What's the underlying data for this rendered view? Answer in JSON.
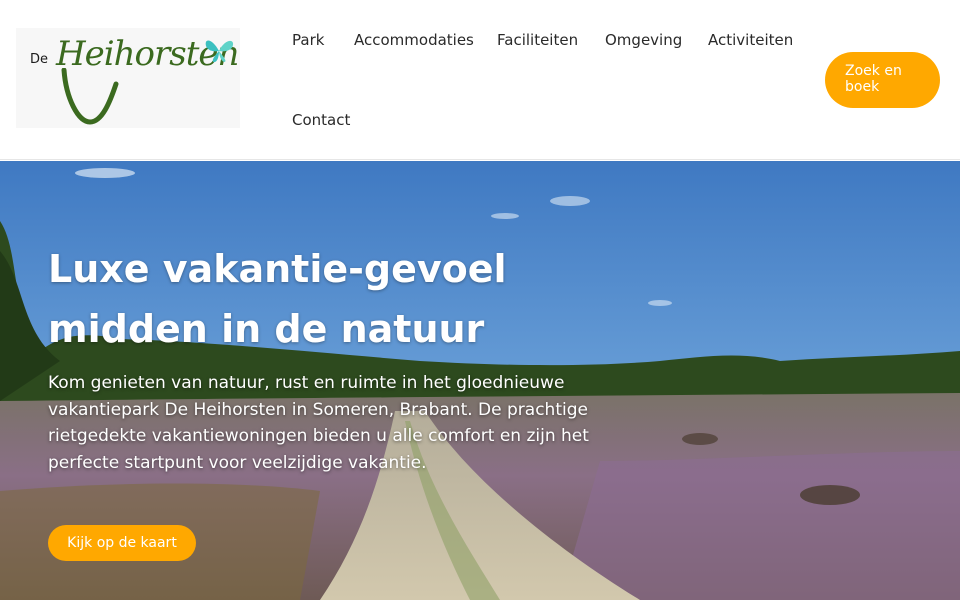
{
  "header": {
    "logo": {
      "prefix": "De",
      "name": "Heihorsten",
      "icon": "butterfly-icon"
    },
    "nav": [
      {
        "label": "Park"
      },
      {
        "label": "Accommodaties"
      },
      {
        "label": "Faciliteiten"
      },
      {
        "label": "Omgeving"
      },
      {
        "label": "Activiteiten"
      },
      {
        "label": "Contact"
      }
    ],
    "cta_label": "Zoek en boek"
  },
  "hero": {
    "title": "Luxe vakantie-gevoel midden in de natuur",
    "text": "Kom genieten van natuur, rust en ruimte in het gloednieuwe vakantiepark De Heihorsten in Someren, Brabant. De prachtige rietgedekte vakantiewoningen bieden u alle comfort en zijn het perfecte startpunt voor veelzijdige vakantie.",
    "button_label": "Kijk op de kaart"
  },
  "colors": {
    "accent": "#ffa800",
    "logo_green": "#3b6a1f",
    "logo_butterfly": "#3cc0c0",
    "nav_text": "#2a2a2a"
  }
}
